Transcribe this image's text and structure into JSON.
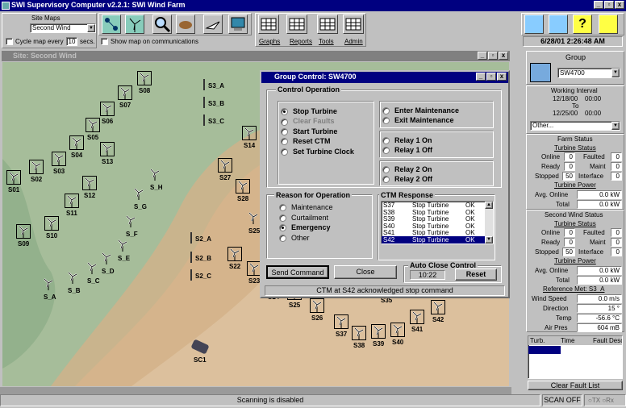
{
  "app": {
    "title": "SWI Supervisory Computer v2.2.1:  SWI Wind Farm"
  },
  "sitemaps": {
    "label": "Site Maps",
    "selected": "Second Wind",
    "cycle_label": "Cycle map every",
    "cycle_value": "10",
    "cycle_unit": "secs.",
    "show_map_label": "Show map on communications"
  },
  "toolbar": {
    "graphs": "Graphs",
    "reports": "Reports",
    "tools": "Tools",
    "admin": "Admin"
  },
  "datetime": "6/28/01 2:26:48 AM",
  "site": {
    "title": "Site: Second Wind",
    "sc1": "SC1",
    "scanning": "Scanning is disabled",
    "scan_off": "SCAN OFF",
    "tx": "TX",
    "rx": "Rx"
  },
  "turbines": {
    "S01": "S01",
    "S02": "S02",
    "S03": "S03",
    "S04": "S04",
    "S05": "S05",
    "S06": "S06",
    "S07": "S07",
    "S08": "S08",
    "S09": "S09",
    "S10": "S10",
    "S11": "S11",
    "S12": "S12",
    "S13": "S13",
    "S14": "S14",
    "S22": "S22",
    "S23": "S23",
    "S24": "S24",
    "S25": "S25",
    "S26": "S26",
    "S27": "S27",
    "S28": "S28",
    "S35": "S35",
    "S37": "S37",
    "S38": "S38",
    "S39": "S39",
    "S40": "S40",
    "S41": "S41",
    "S42": "S42",
    "S_A": "S_A",
    "S_B": "S_B",
    "S_C": "S_C",
    "S_D": "S_D",
    "S_E": "S_E",
    "S_F": "S_F",
    "S_G": "S_G",
    "S_H": "S_H",
    "S2_A": "S2_A",
    "S2_B": "S2_B",
    "S2_C": "S2_C",
    "S3_A": "S3_A",
    "S3_B": "S3_B",
    "S3_C": "S3_C",
    "S25b": "S25"
  },
  "dialog": {
    "title": "Group Control: SW4700",
    "control_op": "Control Operation",
    "ops_left": [
      "Stop Turbine",
      "Clear Faults",
      "Start Turbine",
      "Reset CTM",
      "Set Turbine Clock"
    ],
    "ops_right1": [
      "Enter Maintenance",
      "Exit Maintenance"
    ],
    "ops_right2": [
      "Relay 1 On",
      "Relay 1 Off"
    ],
    "ops_right3": [
      "Relay 2 On",
      "Relay 2 Off"
    ],
    "reason": "Reason for Operation",
    "reasons": [
      "Maintenance",
      "Curtailment",
      "Emergency",
      "Other"
    ],
    "ctm": "CTM Response",
    "responses": [
      [
        "S37",
        "Stop Turbine",
        "OK"
      ],
      [
        "S38",
        "Stop Turbine",
        "OK"
      ],
      [
        "S39",
        "Stop Turbine",
        "OK"
      ],
      [
        "S40",
        "Stop Turbine",
        "OK"
      ],
      [
        "S41",
        "Stop Turbine",
        "OK"
      ],
      [
        "S42",
        "Stop Turbine",
        "OK"
      ]
    ],
    "send": "Send Command",
    "close": "Close",
    "auto_close": "Auto Close Control",
    "auto_time": "10:22",
    "reset": "Reset",
    "status": "CTM at S42 acknowledged stop command"
  },
  "right": {
    "group_label": "Group",
    "group_value": "SW4700",
    "wi_label": "Working Interval",
    "wi_from": "12/18/00",
    "wi_from_t": "00:00",
    "wi_to": "To",
    "wi_to_d": "12/25/00",
    "wi_to_t": "00:00",
    "other": "Other...",
    "farm_status": "Farm Status",
    "turbine_status": "Turbine Status",
    "online": "Online",
    "faulted": "Faulted",
    "ready": "Ready",
    "maint": "Maint",
    "stopped": "Stopped",
    "interface": "Interface",
    "farm_vals": {
      "online": "0",
      "faulted": "0",
      "ready": "0",
      "maint": "0",
      "stopped": "50",
      "interface": "0"
    },
    "turbine_power": "Turbine Power",
    "avg_online": "Avg. Online",
    "total": "Total",
    "farm_power": {
      "avg": "0.0 kW",
      "total": "0.0 kW"
    },
    "sw_status": "Second Wind Status",
    "sw_vals": {
      "online": "0",
      "faulted": "0",
      "ready": "0",
      "maint": "0",
      "stopped": "50",
      "interface": "0"
    },
    "sw_power": {
      "avg": "0.0 kW",
      "total": "0.0 kW"
    },
    "ref_met": "Reference Met: S3_A",
    "wind_speed": "Wind Speed",
    "wind_speed_v": "0.0 m/s",
    "direction": "Direction",
    "direction_v": "15 °",
    "temp": "Temp",
    "temp_v": "-56.6 °C",
    "air_pres": "Air Pres",
    "air_pres_v": "604 mB",
    "fault_cols": [
      "Turb.",
      "Time",
      "Fault Desc"
    ],
    "clear": "Clear Fault List"
  },
  "colors": {
    "title": "#000080",
    "select": "#000080",
    "terrain": "#9ab68e",
    "sand": "#d7b890"
  }
}
